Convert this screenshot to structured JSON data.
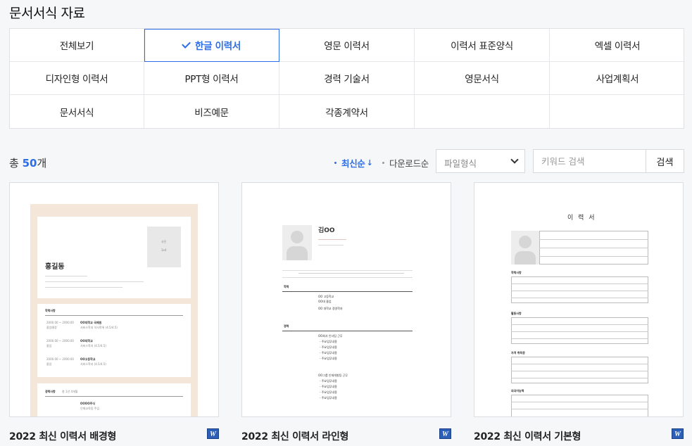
{
  "page": {
    "title": "문서서식 자료"
  },
  "categories": [
    {
      "label": "전체보기",
      "active": false
    },
    {
      "label": "한글 이력서",
      "active": true
    },
    {
      "label": "영문 이력서",
      "active": false
    },
    {
      "label": "이력서 표준양식",
      "active": false
    },
    {
      "label": "엑셀 이력서",
      "active": false
    },
    {
      "label": "디자인형 이력서",
      "active": false
    },
    {
      "label": "PPT형 이력서",
      "active": false
    },
    {
      "label": "경력 기술서",
      "active": false
    },
    {
      "label": "영문서식",
      "active": false
    },
    {
      "label": "사업계획서",
      "active": false
    },
    {
      "label": "문서서식",
      "active": false
    },
    {
      "label": "비즈예문",
      "active": false
    },
    {
      "label": "각종계약서",
      "active": false
    },
    {
      "label": "",
      "active": false
    },
    {
      "label": "",
      "active": false
    }
  ],
  "toolbar": {
    "total_prefix": "총",
    "total_count": "50",
    "total_suffix": "개",
    "sort_newest": "최신순",
    "sort_downloads": "다운로드순",
    "file_format_select": "파일형식",
    "search_placeholder": "키워드 검색",
    "search_button": "검색"
  },
  "cards": [
    {
      "title": "2022 최신 이력서 배경형",
      "file_icon": "W",
      "preview": {
        "photo_label": "사진",
        "photo_sub": "3x4",
        "name": "홍길동",
        "edu_heading": "학력사항",
        "edu": [
          {
            "date": "2000.00 ~ 2000.00",
            "school": "OO대학교 국제원",
            "major": "서비스학과 석사학위 (4.5/4.5)",
            "status": "졸업예정"
          },
          {
            "date": "2000.00 ~ 2000.00",
            "school": "OO대학교",
            "major": "서비스학과 (4.5/4.5)",
            "status": "졸업"
          },
          {
            "date": "2000.00 ~ 2000.00",
            "school": "OO고등학교",
            "major": "서비스학과 (4.5/4.5)",
            "status": "졸업"
          }
        ],
        "career_heading": "경력사항",
        "career_sub": "총 1년 4개월",
        "career_company": "OOOO주식",
        "career_role": "인재교육팀 주임"
      }
    },
    {
      "title": "2022 최신 이력서 라인형",
      "file_icon": "W",
      "preview": {
        "name": "김OO",
        "edu_heading": "학력",
        "edu_1": "OO 고등학교",
        "edu_2": "OO대 졸업",
        "edu_3": "OO 대학교 경영학과",
        "career_heading": "경력",
        "career_1": "OO회사 인사팀 근무",
        "career_2": "OO그룹 인재개발팀 근무",
        "duty": "- 주요업무내용"
      }
    },
    {
      "title": "2022 최신 이력서 기본형",
      "file_icon": "W",
      "preview": {
        "doc_title": "이 력 서",
        "section_1": "학력사항",
        "section_2": "활동사항",
        "section_3": "자격 취득증",
        "section_4": "외국어능력"
      }
    }
  ],
  "colors": {
    "accent": "#2c6ee8",
    "card_bg_beige": "#f4e7da",
    "word_blue": "#2b5fb8"
  }
}
